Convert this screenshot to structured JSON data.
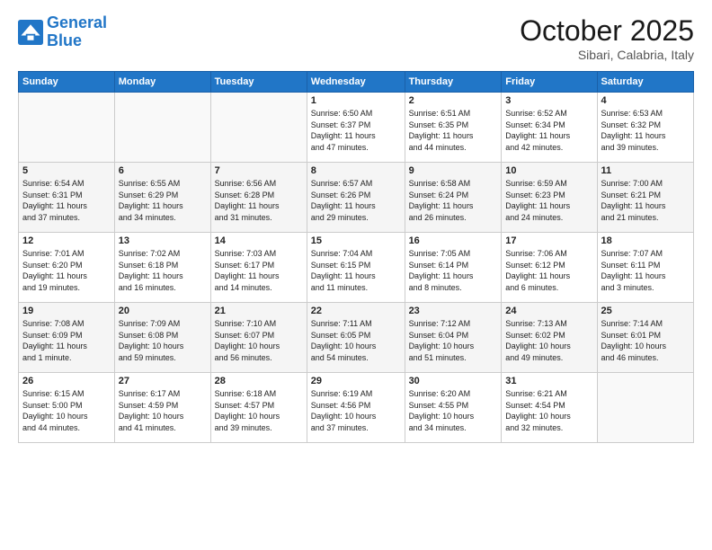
{
  "header": {
    "logo_line1": "General",
    "logo_line2": "Blue",
    "month": "October 2025",
    "location": "Sibari, Calabria, Italy"
  },
  "weekdays": [
    "Sunday",
    "Monday",
    "Tuesday",
    "Wednesday",
    "Thursday",
    "Friday",
    "Saturday"
  ],
  "weeks": [
    [
      {
        "day": "",
        "info": ""
      },
      {
        "day": "",
        "info": ""
      },
      {
        "day": "",
        "info": ""
      },
      {
        "day": "1",
        "info": "Sunrise: 6:50 AM\nSunset: 6:37 PM\nDaylight: 11 hours\nand 47 minutes."
      },
      {
        "day": "2",
        "info": "Sunrise: 6:51 AM\nSunset: 6:35 PM\nDaylight: 11 hours\nand 44 minutes."
      },
      {
        "day": "3",
        "info": "Sunrise: 6:52 AM\nSunset: 6:34 PM\nDaylight: 11 hours\nand 42 minutes."
      },
      {
        "day": "4",
        "info": "Sunrise: 6:53 AM\nSunset: 6:32 PM\nDaylight: 11 hours\nand 39 minutes."
      }
    ],
    [
      {
        "day": "5",
        "info": "Sunrise: 6:54 AM\nSunset: 6:31 PM\nDaylight: 11 hours\nand 37 minutes."
      },
      {
        "day": "6",
        "info": "Sunrise: 6:55 AM\nSunset: 6:29 PM\nDaylight: 11 hours\nand 34 minutes."
      },
      {
        "day": "7",
        "info": "Sunrise: 6:56 AM\nSunset: 6:28 PM\nDaylight: 11 hours\nand 31 minutes."
      },
      {
        "day": "8",
        "info": "Sunrise: 6:57 AM\nSunset: 6:26 PM\nDaylight: 11 hours\nand 29 minutes."
      },
      {
        "day": "9",
        "info": "Sunrise: 6:58 AM\nSunset: 6:24 PM\nDaylight: 11 hours\nand 26 minutes."
      },
      {
        "day": "10",
        "info": "Sunrise: 6:59 AM\nSunset: 6:23 PM\nDaylight: 11 hours\nand 24 minutes."
      },
      {
        "day": "11",
        "info": "Sunrise: 7:00 AM\nSunset: 6:21 PM\nDaylight: 11 hours\nand 21 minutes."
      }
    ],
    [
      {
        "day": "12",
        "info": "Sunrise: 7:01 AM\nSunset: 6:20 PM\nDaylight: 11 hours\nand 19 minutes."
      },
      {
        "day": "13",
        "info": "Sunrise: 7:02 AM\nSunset: 6:18 PM\nDaylight: 11 hours\nand 16 minutes."
      },
      {
        "day": "14",
        "info": "Sunrise: 7:03 AM\nSunset: 6:17 PM\nDaylight: 11 hours\nand 14 minutes."
      },
      {
        "day": "15",
        "info": "Sunrise: 7:04 AM\nSunset: 6:15 PM\nDaylight: 11 hours\nand 11 minutes."
      },
      {
        "day": "16",
        "info": "Sunrise: 7:05 AM\nSunset: 6:14 PM\nDaylight: 11 hours\nand 8 minutes."
      },
      {
        "day": "17",
        "info": "Sunrise: 7:06 AM\nSunset: 6:12 PM\nDaylight: 11 hours\nand 6 minutes."
      },
      {
        "day": "18",
        "info": "Sunrise: 7:07 AM\nSunset: 6:11 PM\nDaylight: 11 hours\nand 3 minutes."
      }
    ],
    [
      {
        "day": "19",
        "info": "Sunrise: 7:08 AM\nSunset: 6:09 PM\nDaylight: 11 hours\nand 1 minute."
      },
      {
        "day": "20",
        "info": "Sunrise: 7:09 AM\nSunset: 6:08 PM\nDaylight: 10 hours\nand 59 minutes."
      },
      {
        "day": "21",
        "info": "Sunrise: 7:10 AM\nSunset: 6:07 PM\nDaylight: 10 hours\nand 56 minutes."
      },
      {
        "day": "22",
        "info": "Sunrise: 7:11 AM\nSunset: 6:05 PM\nDaylight: 10 hours\nand 54 minutes."
      },
      {
        "day": "23",
        "info": "Sunrise: 7:12 AM\nSunset: 6:04 PM\nDaylight: 10 hours\nand 51 minutes."
      },
      {
        "day": "24",
        "info": "Sunrise: 7:13 AM\nSunset: 6:02 PM\nDaylight: 10 hours\nand 49 minutes."
      },
      {
        "day": "25",
        "info": "Sunrise: 7:14 AM\nSunset: 6:01 PM\nDaylight: 10 hours\nand 46 minutes."
      }
    ],
    [
      {
        "day": "26",
        "info": "Sunrise: 6:15 AM\nSunset: 5:00 PM\nDaylight: 10 hours\nand 44 minutes."
      },
      {
        "day": "27",
        "info": "Sunrise: 6:17 AM\nSunset: 4:59 PM\nDaylight: 10 hours\nand 41 minutes."
      },
      {
        "day": "28",
        "info": "Sunrise: 6:18 AM\nSunset: 4:57 PM\nDaylight: 10 hours\nand 39 minutes."
      },
      {
        "day": "29",
        "info": "Sunrise: 6:19 AM\nSunset: 4:56 PM\nDaylight: 10 hours\nand 37 minutes."
      },
      {
        "day": "30",
        "info": "Sunrise: 6:20 AM\nSunset: 4:55 PM\nDaylight: 10 hours\nand 34 minutes."
      },
      {
        "day": "31",
        "info": "Sunrise: 6:21 AM\nSunset: 4:54 PM\nDaylight: 10 hours\nand 32 minutes."
      },
      {
        "day": "",
        "info": ""
      }
    ]
  ]
}
